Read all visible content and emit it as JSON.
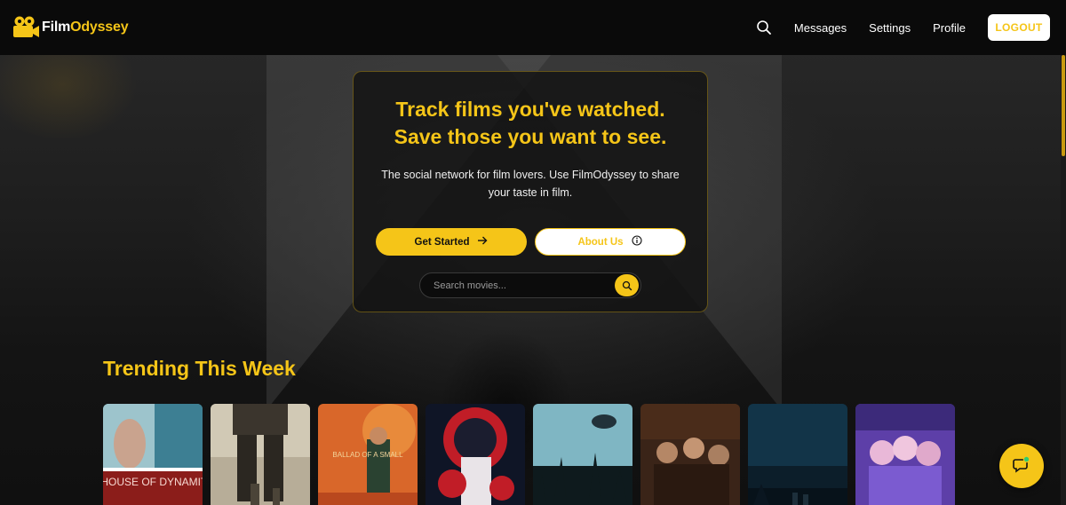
{
  "brand": {
    "name_part1": "Film",
    "name_part2": "Odyssey",
    "accent": "#f5c518"
  },
  "nav": {
    "search_icon": "search-icon",
    "links": [
      "Messages",
      "Settings",
      "Profile"
    ],
    "logout_label": "LOGOUT"
  },
  "hero": {
    "title_line1": "Track films you've watched.",
    "title_line2": "Save those you want to see.",
    "subtitle": "The social network for film lovers. Use FilmOdyssey to share your taste in film.",
    "primary_button": "Get Started",
    "primary_icon": "arrow-right-icon",
    "secondary_button": "About Us",
    "secondary_icon": "info-icon",
    "search_placeholder": "Search movies...",
    "search_icon": "search-icon"
  },
  "trending": {
    "title": "Trending This Week",
    "posters": [
      {
        "id": "poster-1",
        "title": "A HOUSE OF DYNAMITE"
      },
      {
        "id": "poster-2"
      },
      {
        "id": "poster-3",
        "title": "BALLAD OF A SMALL"
      },
      {
        "id": "poster-4"
      },
      {
        "id": "poster-5"
      },
      {
        "id": "poster-6"
      },
      {
        "id": "poster-7"
      },
      {
        "id": "poster-8"
      }
    ]
  },
  "chat": {
    "icon": "chat-icon"
  }
}
